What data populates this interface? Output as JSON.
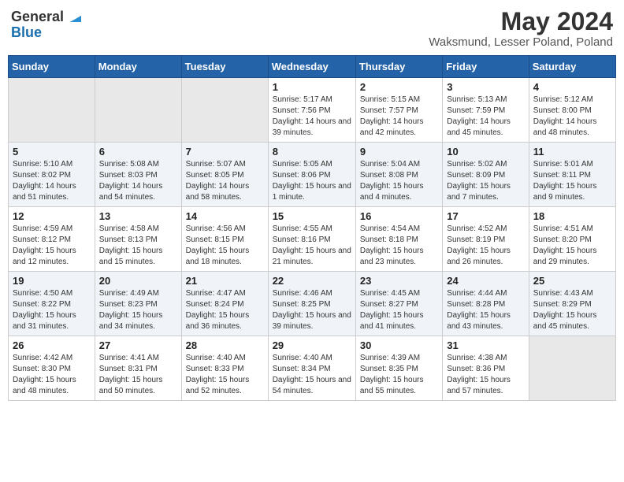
{
  "header": {
    "logo_general": "General",
    "logo_blue": "Blue",
    "month_title": "May 2024",
    "location": "Waksmund, Lesser Poland, Poland"
  },
  "days_of_week": [
    "Sunday",
    "Monday",
    "Tuesday",
    "Wednesday",
    "Thursday",
    "Friday",
    "Saturday"
  ],
  "weeks": [
    [
      {
        "day": "",
        "sunrise": "",
        "sunset": "",
        "daylight": ""
      },
      {
        "day": "",
        "sunrise": "",
        "sunset": "",
        "daylight": ""
      },
      {
        "day": "",
        "sunrise": "",
        "sunset": "",
        "daylight": ""
      },
      {
        "day": "1",
        "sunrise": "Sunrise: 5:17 AM",
        "sunset": "Sunset: 7:56 PM",
        "daylight": "Daylight: 14 hours and 39 minutes."
      },
      {
        "day": "2",
        "sunrise": "Sunrise: 5:15 AM",
        "sunset": "Sunset: 7:57 PM",
        "daylight": "Daylight: 14 hours and 42 minutes."
      },
      {
        "day": "3",
        "sunrise": "Sunrise: 5:13 AM",
        "sunset": "Sunset: 7:59 PM",
        "daylight": "Daylight: 14 hours and 45 minutes."
      },
      {
        "day": "4",
        "sunrise": "Sunrise: 5:12 AM",
        "sunset": "Sunset: 8:00 PM",
        "daylight": "Daylight: 14 hours and 48 minutes."
      }
    ],
    [
      {
        "day": "5",
        "sunrise": "Sunrise: 5:10 AM",
        "sunset": "Sunset: 8:02 PM",
        "daylight": "Daylight: 14 hours and 51 minutes."
      },
      {
        "day": "6",
        "sunrise": "Sunrise: 5:08 AM",
        "sunset": "Sunset: 8:03 PM",
        "daylight": "Daylight: 14 hours and 54 minutes."
      },
      {
        "day": "7",
        "sunrise": "Sunrise: 5:07 AM",
        "sunset": "Sunset: 8:05 PM",
        "daylight": "Daylight: 14 hours and 58 minutes."
      },
      {
        "day": "8",
        "sunrise": "Sunrise: 5:05 AM",
        "sunset": "Sunset: 8:06 PM",
        "daylight": "Daylight: 15 hours and 1 minute."
      },
      {
        "day": "9",
        "sunrise": "Sunrise: 5:04 AM",
        "sunset": "Sunset: 8:08 PM",
        "daylight": "Daylight: 15 hours and 4 minutes."
      },
      {
        "day": "10",
        "sunrise": "Sunrise: 5:02 AM",
        "sunset": "Sunset: 8:09 PM",
        "daylight": "Daylight: 15 hours and 7 minutes."
      },
      {
        "day": "11",
        "sunrise": "Sunrise: 5:01 AM",
        "sunset": "Sunset: 8:11 PM",
        "daylight": "Daylight: 15 hours and 9 minutes."
      }
    ],
    [
      {
        "day": "12",
        "sunrise": "Sunrise: 4:59 AM",
        "sunset": "Sunset: 8:12 PM",
        "daylight": "Daylight: 15 hours and 12 minutes."
      },
      {
        "day": "13",
        "sunrise": "Sunrise: 4:58 AM",
        "sunset": "Sunset: 8:13 PM",
        "daylight": "Daylight: 15 hours and 15 minutes."
      },
      {
        "day": "14",
        "sunrise": "Sunrise: 4:56 AM",
        "sunset": "Sunset: 8:15 PM",
        "daylight": "Daylight: 15 hours and 18 minutes."
      },
      {
        "day": "15",
        "sunrise": "Sunrise: 4:55 AM",
        "sunset": "Sunset: 8:16 PM",
        "daylight": "Daylight: 15 hours and 21 minutes."
      },
      {
        "day": "16",
        "sunrise": "Sunrise: 4:54 AM",
        "sunset": "Sunset: 8:18 PM",
        "daylight": "Daylight: 15 hours and 23 minutes."
      },
      {
        "day": "17",
        "sunrise": "Sunrise: 4:52 AM",
        "sunset": "Sunset: 8:19 PM",
        "daylight": "Daylight: 15 hours and 26 minutes."
      },
      {
        "day": "18",
        "sunrise": "Sunrise: 4:51 AM",
        "sunset": "Sunset: 8:20 PM",
        "daylight": "Daylight: 15 hours and 29 minutes."
      }
    ],
    [
      {
        "day": "19",
        "sunrise": "Sunrise: 4:50 AM",
        "sunset": "Sunset: 8:22 PM",
        "daylight": "Daylight: 15 hours and 31 minutes."
      },
      {
        "day": "20",
        "sunrise": "Sunrise: 4:49 AM",
        "sunset": "Sunset: 8:23 PM",
        "daylight": "Daylight: 15 hours and 34 minutes."
      },
      {
        "day": "21",
        "sunrise": "Sunrise: 4:47 AM",
        "sunset": "Sunset: 8:24 PM",
        "daylight": "Daylight: 15 hours and 36 minutes."
      },
      {
        "day": "22",
        "sunrise": "Sunrise: 4:46 AM",
        "sunset": "Sunset: 8:25 PM",
        "daylight": "Daylight: 15 hours and 39 minutes."
      },
      {
        "day": "23",
        "sunrise": "Sunrise: 4:45 AM",
        "sunset": "Sunset: 8:27 PM",
        "daylight": "Daylight: 15 hours and 41 minutes."
      },
      {
        "day": "24",
        "sunrise": "Sunrise: 4:44 AM",
        "sunset": "Sunset: 8:28 PM",
        "daylight": "Daylight: 15 hours and 43 minutes."
      },
      {
        "day": "25",
        "sunrise": "Sunrise: 4:43 AM",
        "sunset": "Sunset: 8:29 PM",
        "daylight": "Daylight: 15 hours and 45 minutes."
      }
    ],
    [
      {
        "day": "26",
        "sunrise": "Sunrise: 4:42 AM",
        "sunset": "Sunset: 8:30 PM",
        "daylight": "Daylight: 15 hours and 48 minutes."
      },
      {
        "day": "27",
        "sunrise": "Sunrise: 4:41 AM",
        "sunset": "Sunset: 8:31 PM",
        "daylight": "Daylight: 15 hours and 50 minutes."
      },
      {
        "day": "28",
        "sunrise": "Sunrise: 4:40 AM",
        "sunset": "Sunset: 8:33 PM",
        "daylight": "Daylight: 15 hours and 52 minutes."
      },
      {
        "day": "29",
        "sunrise": "Sunrise: 4:40 AM",
        "sunset": "Sunset: 8:34 PM",
        "daylight": "Daylight: 15 hours and 54 minutes."
      },
      {
        "day": "30",
        "sunrise": "Sunrise: 4:39 AM",
        "sunset": "Sunset: 8:35 PM",
        "daylight": "Daylight: 15 hours and 55 minutes."
      },
      {
        "day": "31",
        "sunrise": "Sunrise: 4:38 AM",
        "sunset": "Sunset: 8:36 PM",
        "daylight": "Daylight: 15 hours and 57 minutes."
      },
      {
        "day": "",
        "sunrise": "",
        "sunset": "",
        "daylight": ""
      }
    ]
  ]
}
